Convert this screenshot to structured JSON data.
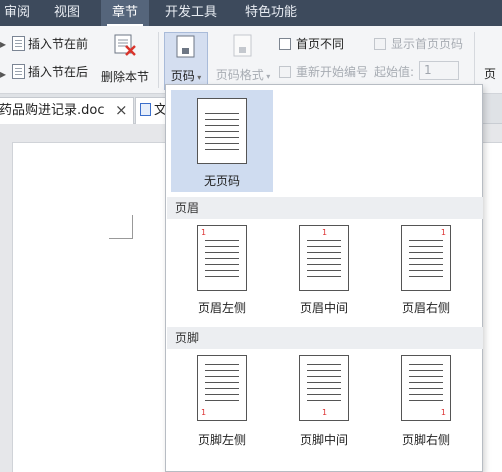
{
  "menu": {
    "items": [
      "审阅",
      "视图",
      "章节",
      "开发工具",
      "特色功能"
    ],
    "active": "章节"
  },
  "ribbon": {
    "insert_section_before": "插入节在前",
    "insert_section_after": "插入节在后",
    "delete_section": "删除本节",
    "page_number": "页码",
    "page_number_format": "页码格式",
    "first_page_different": "首页不同",
    "show_first_page_number": "显示首页页码",
    "restart_numbering": "重新开始编号",
    "start_value_label": "起始值:",
    "start_value": "1",
    "right_cut_label": "页"
  },
  "tabs": {
    "doc_name": "药品购进记录.doc",
    "second_tab_partial": "文"
  },
  "dropdown": {
    "none": {
      "label": "无页码"
    },
    "header_section": "页眉",
    "header_options": [
      {
        "label": "页眉左侧",
        "num": "1"
      },
      {
        "label": "页眉中间",
        "num": "1"
      },
      {
        "label": "页眉右侧",
        "num": "1"
      }
    ],
    "footer_section": "页脚",
    "footer_options": [
      {
        "label": "页脚左侧",
        "num": "1"
      },
      {
        "label": "页脚中间",
        "num": "1"
      },
      {
        "label": "页脚右侧",
        "num": "1"
      }
    ]
  }
}
